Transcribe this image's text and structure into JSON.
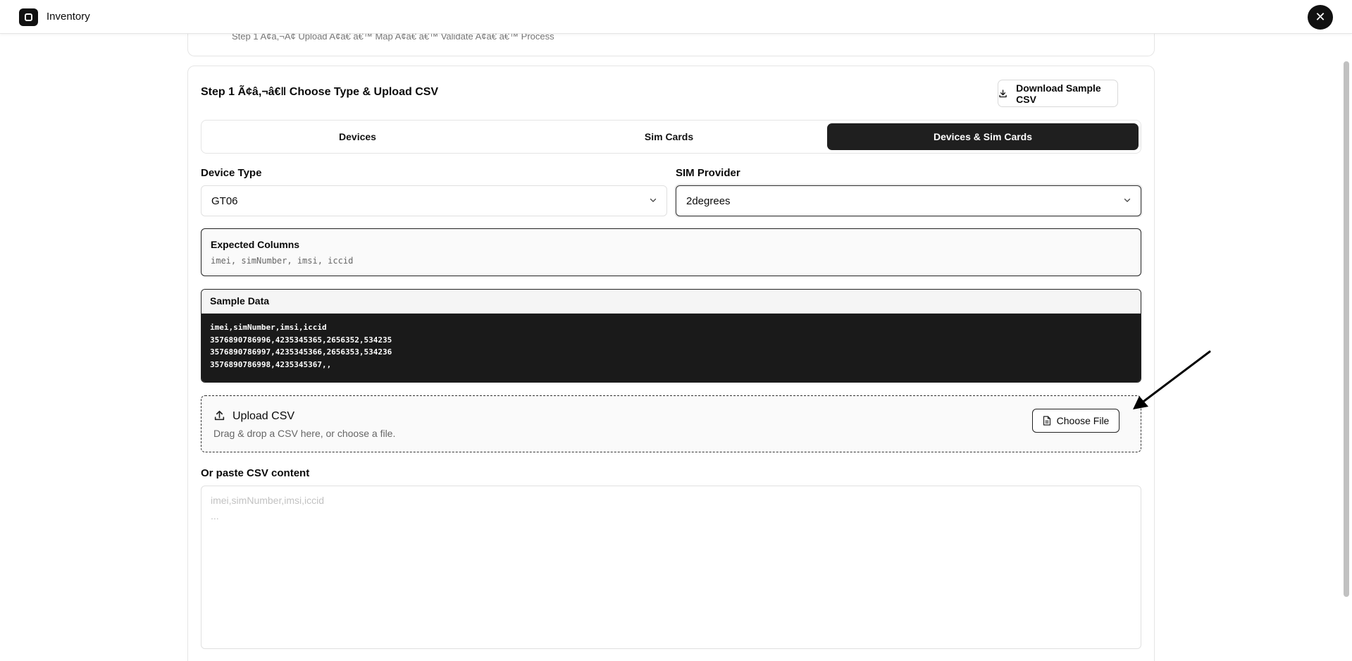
{
  "app": {
    "title": "Inventory"
  },
  "previous_step": {
    "steps_text": "Step 1 A¢â,¬A¢ Upload A¢â€ â€™ Map A¢â€ â€™ Validate A¢â€ â€™ Process"
  },
  "card": {
    "title": "Step 1 Ã¢â,¬â€‖ Choose Type & Upload CSV",
    "download_label": "Download Sample CSV"
  },
  "tabs": [
    {
      "label": "Devices",
      "active": false
    },
    {
      "label": "Sim Cards",
      "active": false
    },
    {
      "label": "Devices & Sim Cards",
      "active": true
    }
  ],
  "device_type": {
    "label": "Device Type",
    "value": "GT06"
  },
  "sim_provider": {
    "label": "SIM Provider",
    "value": "2degrees"
  },
  "expected": {
    "title": "Expected Columns",
    "columns": "imei, simNumber, imsi, iccid"
  },
  "sample": {
    "title": "Sample Data",
    "lines": [
      "imei,simNumber,imsi,iccid",
      "3576890786996,4235345365,2656352,534235",
      "3576890786997,4235345366,2656353,534236",
      "3576890786998,4235345367,,"
    ]
  },
  "upload": {
    "title": "Upload CSV",
    "subtitle": "Drag & drop a CSV here, or choose a file.",
    "button_label": "Choose File"
  },
  "paste": {
    "label": "Or paste CSV content",
    "placeholder_line1": "imei,simNumber,imsi,iccid",
    "placeholder_line2": "..."
  },
  "icons": {
    "logo": "app-logo-icon",
    "close": "close-icon",
    "download": "download-icon",
    "chevron": "chevron-down-icon",
    "upload": "upload-icon",
    "file": "file-icon"
  }
}
